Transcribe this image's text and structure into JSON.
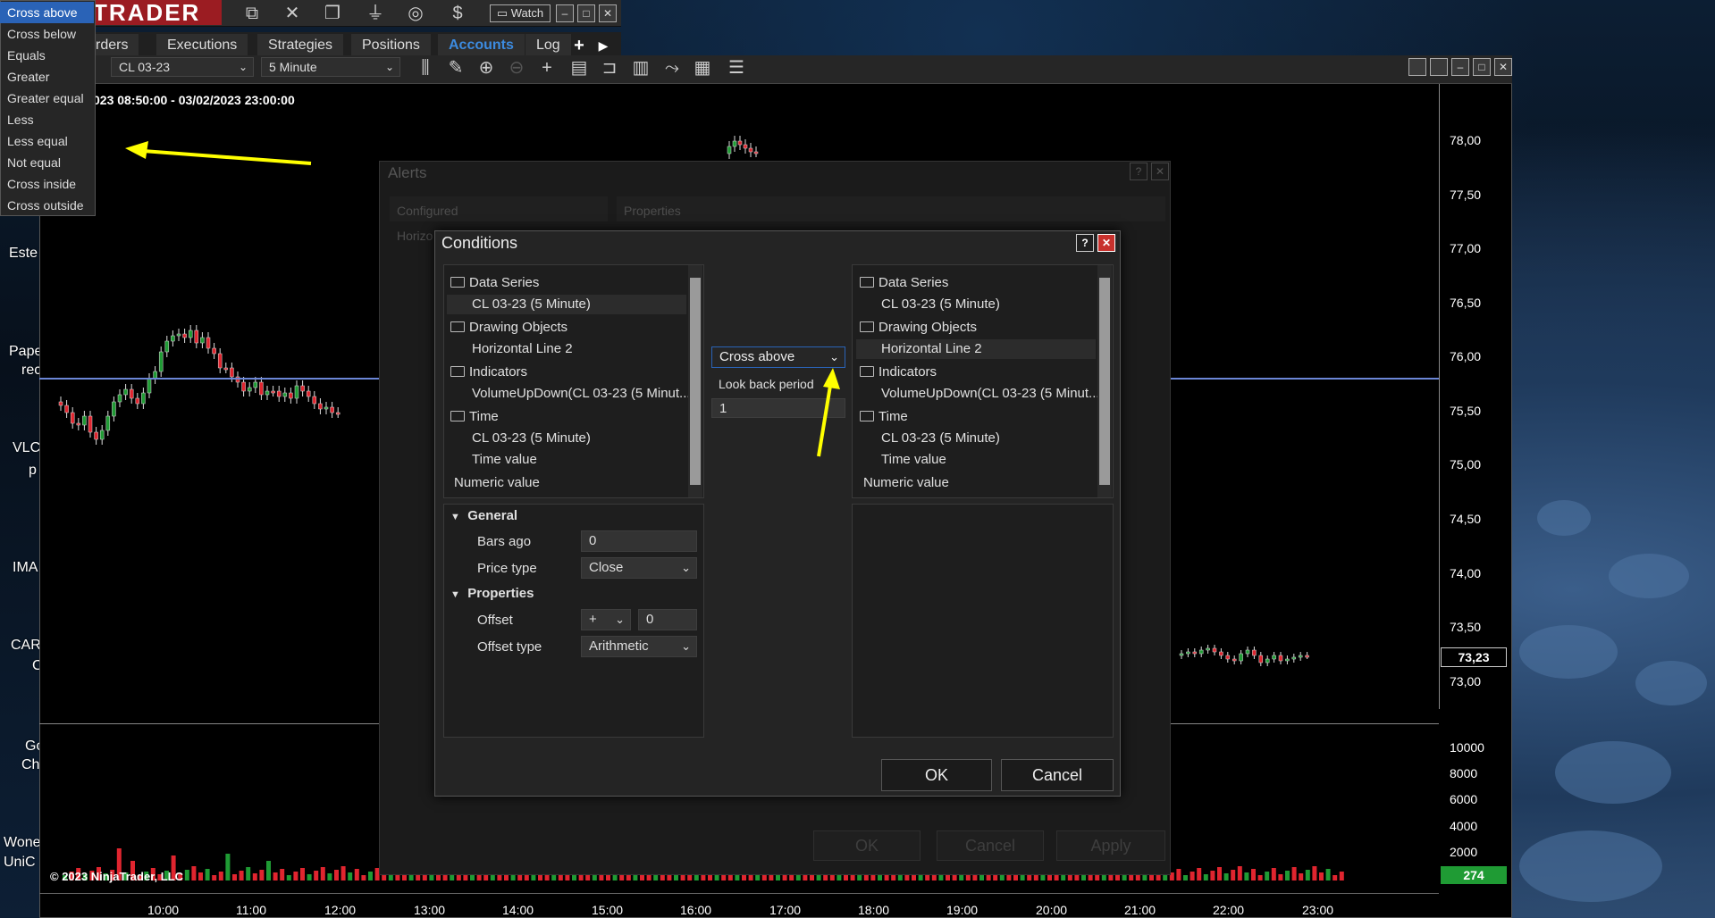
{
  "app": {
    "logo": "TRADER",
    "watch_label": "Watch"
  },
  "tabs": [
    {
      "label": "rders"
    },
    {
      "label": "Executions"
    },
    {
      "label": "Strategies"
    },
    {
      "label": "Positions"
    },
    {
      "label": "Accounts"
    },
    {
      "label": "Log"
    }
  ],
  "chart": {
    "instrument": "CL 03-23",
    "interval": "5 Minute",
    "range": "023 08:50:00 - 03/02/2023 23:00:00",
    "copyright": "© 2023 NinjaTrader, LLC",
    "current_price": "73,23",
    "current_volume": "274",
    "price_labels": [
      "78,00",
      "77,50",
      "77,00",
      "76,50",
      "76,00",
      "75,50",
      "75,00",
      "74,50",
      "74,00",
      "73,50",
      "73,00"
    ],
    "volume_labels": [
      "10000",
      "8000",
      "6000",
      "4000",
      "2000"
    ],
    "time_labels": [
      "10:00",
      "11:00",
      "12:00",
      "13:00",
      "14:00",
      "15:00",
      "16:00",
      "17:00",
      "18:00",
      "19:00",
      "20:00",
      "21:00",
      "22:00",
      "23:00"
    ]
  },
  "desktop_labels": [
    "Este",
    "Pape",
    "rec",
    "VLC",
    "p",
    "IMA",
    "CAR",
    "C",
    "Go",
    "Ch",
    "Wone",
    "UniC"
  ],
  "alerts": {
    "title": "Alerts",
    "configured": "Configured",
    "properties": "Properties",
    "horizontal": "Horizo",
    "ok": "OK",
    "cancel": "Cancel",
    "apply": "Apply"
  },
  "conditions": {
    "title": "Conditions",
    "left_tree": {
      "data_series": "Data Series",
      "data_series_item": "CL 03-23 (5 Minute)",
      "drawing_objects": "Drawing Objects",
      "drawing_item": "Horizontal Line 2",
      "indicators": "Indicators",
      "indicator_item": "VolumeUpDown(CL 03-23 (5 Minut...",
      "time": "Time",
      "time_item1": "CL 03-23 (5 Minute)",
      "time_item2": "Time value",
      "numeric": "Numeric value"
    },
    "right_tree": {
      "data_series": "Data Series",
      "data_series_item": "CL 03-23 (5 Minute)",
      "drawing_objects": "Drawing Objects",
      "drawing_item": "Horizontal Line 2",
      "indicators": "Indicators",
      "indicator_item": "VolumeUpDown(CL 03-23 (5 Minut...",
      "time": "Time",
      "time_item1": "CL 03-23 (5 Minute)",
      "time_item2": "Time value",
      "numeric": "Numeric value"
    },
    "operator": "Cross above",
    "look_back_label": "Look back period",
    "look_back_value": "1",
    "general": "General",
    "bars_ago_label": "Bars ago",
    "bars_ago_value": "0",
    "price_type_label": "Price type",
    "price_type_value": "Close",
    "properties": "Properties",
    "offset_label": "Offset",
    "offset_sign": "+",
    "offset_value": "0",
    "offset_type_label": "Offset type",
    "offset_type_value": "Arithmetic",
    "ok": "OK",
    "cancel": "Cancel"
  },
  "operator_options": [
    "Cross above",
    "Cross below",
    "Equals",
    "Greater",
    "Greater equal",
    "Less",
    "Less equal",
    "Not equal",
    "Cross inside",
    "Cross outside"
  ],
  "colors": {
    "up": "#1f9b34",
    "down": "#e0252f",
    "accent": "#2a63b7",
    "annotation": "#ffff00",
    "hline": "#6b86d6"
  }
}
